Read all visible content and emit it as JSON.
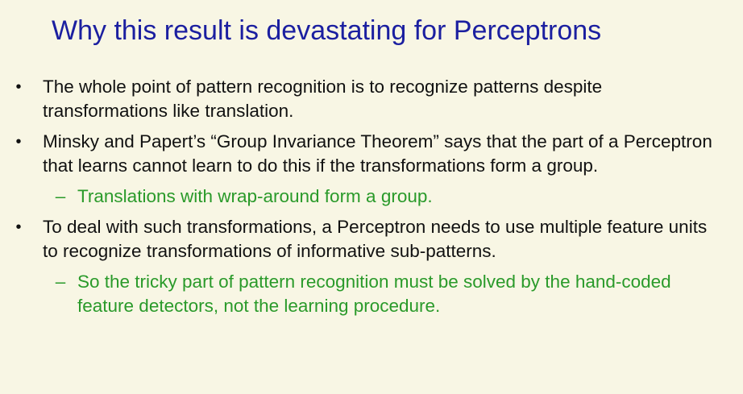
{
  "title": "Why this result is devastating for Perceptrons",
  "bullets": [
    {
      "marker": "•",
      "text": "The whole point of pattern recognition is to recognize patterns despite transformations like translation."
    },
    {
      "marker": "•",
      "text": "Minsky and Papert’s “Group Invariance Theorem” says that the part of a Perceptron that learns cannot learn to do this if the transformations form a group."
    },
    {
      "marker": "–",
      "text": "Translations with wrap-around form a group."
    },
    {
      "marker": "•",
      "text": "To deal with such transformations, a Perceptron needs to use multiple feature units to recognize transformations of informative sub-patterns."
    },
    {
      "marker": "–",
      "text": "So the tricky part of pattern recognition must be solved by the hand-coded feature detectors, not the learning procedure."
    }
  ],
  "colors": {
    "background": "#f8f6e4",
    "title": "#1b1fa0",
    "bullet_text": "#111111",
    "sub_bullet_text": "#2a9a2a"
  }
}
